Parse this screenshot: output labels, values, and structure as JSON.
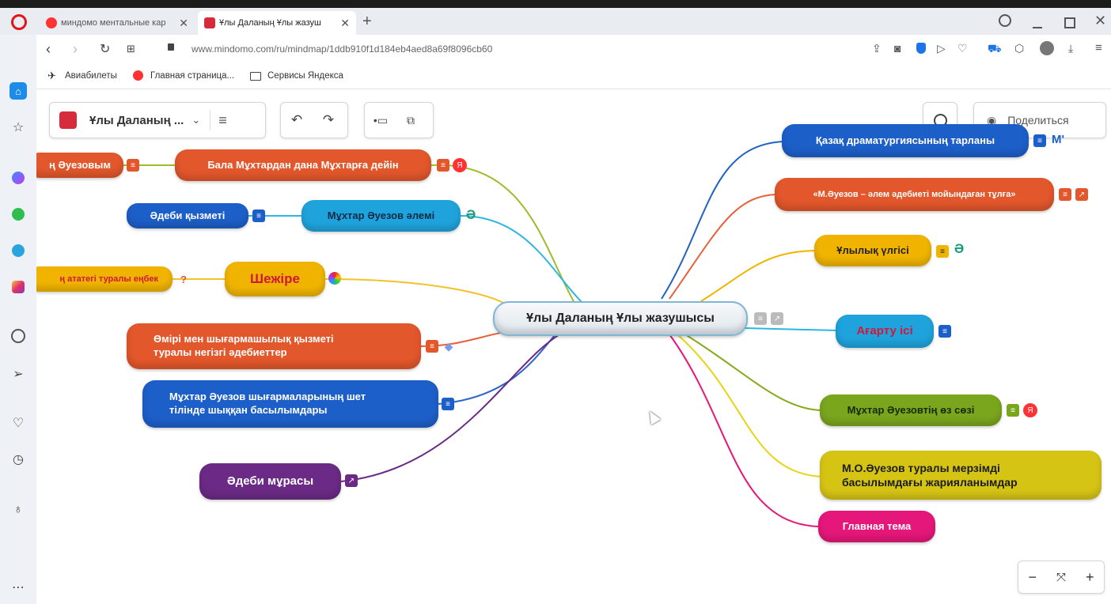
{
  "tabs": [
    {
      "label": "миндомо ментальные кар",
      "close": "✕"
    },
    {
      "label": "Ұлы Даланың Ұлы жазуш",
      "close": "✕"
    }
  ],
  "new_tab": "+",
  "address": {
    "url": "www.mindomo.com/ru/mindmap/1ddb910f1d184eb4aed8a69f8096cb60"
  },
  "bookmarks": [
    "Авиабилеты",
    "Главная страница...",
    "Сервисы Яндекса"
  ],
  "toolbar": {
    "doc_title": "Ұлы Даланың ...",
    "share_label": "Поделиться"
  },
  "zoom": {
    "minus": "−",
    "plus": "+"
  },
  "central_node": "Ұлы Даланың Ұлы жазушысы",
  "left_nodes": {
    "n1a": "ң Әуезовым",
    "n1b": "Бала Мұхтардан дана Мұхтарға дейін",
    "n2a": "Әдеби қызметі",
    "n2b": "Мұхтар Әуезов әлемі",
    "n3a": "ң ататегі туралы еңбек",
    "n3b": "Шежіре",
    "n3q": "?",
    "n4_line1": "Өмірі мен шығармашылық  қызметі",
    "n4_line2": "туралы негізгі әдебиеттер",
    "n5_line1": "Мұхтар Әуезов шығармаларының шет",
    "n5_line2": "тілінде шыққан басылымдары",
    "n6": "Әдеби мұрасы"
  },
  "right_nodes": {
    "r1": "Қазақ драматургиясының тарланы",
    "r1_badge": "M'",
    "r2": "«М.Әуезов – әлем әдебиеті мойындаған тұлға»",
    "r3": "Ұлылық үлгісі",
    "r4": "Ағарту ісі",
    "r5": "Мұхтар Әуезовтің өз сөзі",
    "r6_line1": "М.О.Әуезов туралы мерзімді",
    "r6_line2": "басылымдағы  жарияланымдар",
    "r7": "Главная тема"
  },
  "colors": {
    "orange": "#e2572b",
    "blue": "#1d5fc9",
    "cyan": "#1fa3dc",
    "yellow": "#f0b400",
    "purple": "#6b2a86",
    "green": "#7aa61e",
    "lime": "#d6c415",
    "pink": "#e6177a"
  }
}
